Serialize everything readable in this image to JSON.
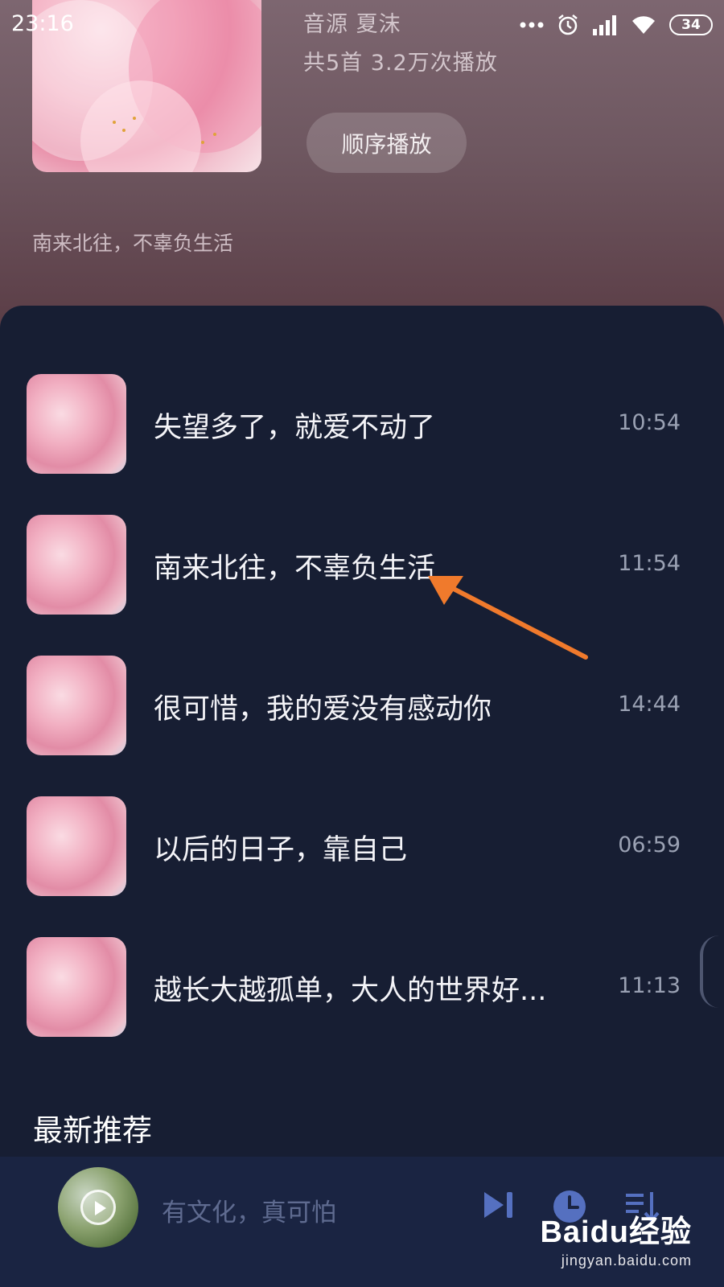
{
  "status_bar": {
    "time": "23:16",
    "battery": "34",
    "icons": [
      "more-dots-icon",
      "alarm-icon",
      "signal-icon",
      "wifi-icon",
      "battery-icon"
    ]
  },
  "album": {
    "source_line": "音源  夏沫",
    "stats_line": "共5首  3.2万次播放",
    "play_mode_button": "顺序播放",
    "description": "南来北往，不辜负生活"
  },
  "songs": [
    {
      "title": "失望多了，就爱不动了",
      "duration": "10:54"
    },
    {
      "title": "南来北往，不辜负生活",
      "duration": "11:54"
    },
    {
      "title": "很可惜，我的爱没有感动你",
      "duration": "14:44"
    },
    {
      "title": "以后的日子，靠自己",
      "duration": "06:59"
    },
    {
      "title": "越长大越孤单，大人的世界好...",
      "duration": "11:13"
    }
  ],
  "section": {
    "title": "最新推荐"
  },
  "player": {
    "now_playing": "有文化，真可怕",
    "controls": [
      "next-icon",
      "timer-icon",
      "playlist-icon"
    ]
  },
  "watermark": {
    "logo": "Baidu经验",
    "url": "jingyan.baidu.com"
  },
  "colors": {
    "panel_bg": "#171e33",
    "player_bg": "#1a2442",
    "arrow": "#f07a2c",
    "control_icon": "#5570c0"
  }
}
